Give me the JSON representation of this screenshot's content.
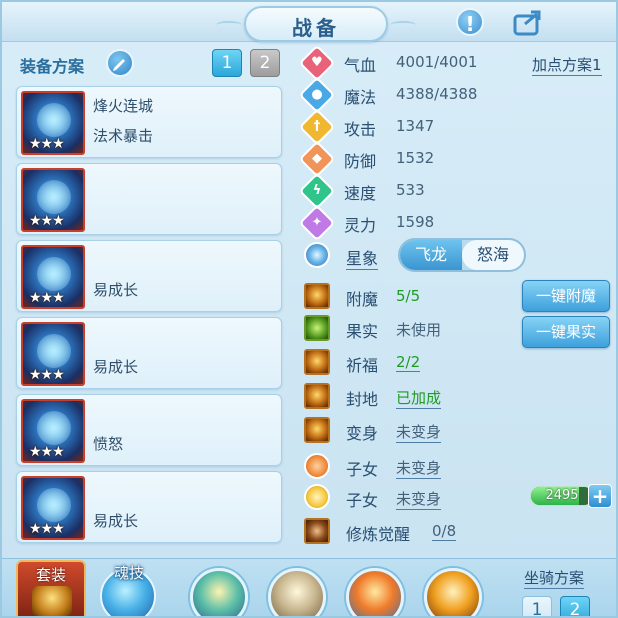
{
  "header": {
    "title": "战备"
  },
  "left": {
    "scheme_title": "装备方案",
    "scheme_buttons": [
      "1",
      "2"
    ],
    "equipment": [
      {
        "line1": "烽火连城",
        "line2": "法术暴击",
        "stars": "★★★"
      },
      {
        "line1": "",
        "line2": "",
        "stars": "★★★"
      },
      {
        "line1": "",
        "line2": "易成长",
        "stars": "★★★"
      },
      {
        "line1": "",
        "line2": "易成长",
        "stars": "★★★"
      },
      {
        "line1": "",
        "line2": "愤怒",
        "stars": "★★★"
      },
      {
        "line1": "",
        "line2": "易成长",
        "stars": "★★★"
      }
    ]
  },
  "stats": {
    "plan_link": "加点方案1",
    "items": [
      {
        "label": "气血",
        "value": "4001/4001",
        "icon": "heart-icon",
        "color": "#e8637a"
      },
      {
        "label": "魔法",
        "value": "4388/4388",
        "icon": "magic-icon",
        "color": "#4aa8e6"
      },
      {
        "label": "攻击",
        "value": "1347",
        "icon": "sword-icon",
        "color": "#f0b830"
      },
      {
        "label": "防御",
        "value": "1532",
        "icon": "shield-icon",
        "color": "#f0945a"
      },
      {
        "label": "速度",
        "value": "533",
        "icon": "lightning-icon",
        "color": "#2fc48a"
      },
      {
        "label": "灵力",
        "value": "1598",
        "icon": "diamond-icon",
        "color": "#c07ae6"
      }
    ],
    "star_sign": {
      "label": "星象",
      "options": [
        "飞龙",
        "怒海"
      ]
    }
  },
  "modifiers": [
    {
      "label": "附魔",
      "value": "5/5",
      "style": "green",
      "button": "一键附魔"
    },
    {
      "label": "果实",
      "value": "未使用",
      "style": "plain",
      "button": "一键果实"
    },
    {
      "label": "祈福",
      "value": "2/2",
      "style": "green-under",
      "button": ""
    },
    {
      "label": "封地",
      "value": "已加成",
      "style": "green-under",
      "button": ""
    },
    {
      "label": "变身",
      "value": "未变身",
      "style": "under",
      "button": ""
    },
    {
      "label": "子女",
      "value": "未变身",
      "style": "under",
      "button": ""
    },
    {
      "label": "子女",
      "value": "未变身",
      "style": "under",
      "button": ""
    },
    {
      "label": "修炼觉醒",
      "value": "0/8",
      "style": "under",
      "button": ""
    }
  ],
  "bar": {
    "value": "2495",
    "fill_fraction": 0.78,
    "plus": "+"
  },
  "bottom": {
    "tab_set": "套装",
    "tab_soul": "魂技",
    "mount_title": "坐骑方案",
    "mount_buttons": [
      "1",
      "2"
    ]
  },
  "colors": {
    "accent": "#2aa7d9",
    "title": "#2b5f8c",
    "green": "#1f9c22",
    "equip_border": "#c83f2c"
  }
}
